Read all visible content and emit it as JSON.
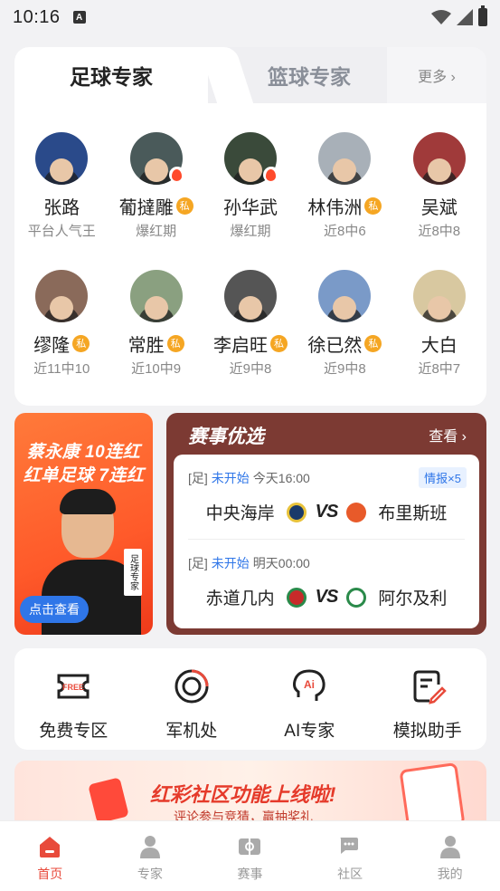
{
  "status_bar": {
    "time": "10:16",
    "a_label": "A"
  },
  "tabs": {
    "active": "足球专家",
    "inactive": "篮球专家",
    "more": "更多 ›"
  },
  "experts": [
    {
      "name": "张路",
      "sub": "平台人气王",
      "private": false,
      "hot": false,
      "color": "#2a4a8a"
    },
    {
      "name": "葡撻雕",
      "sub": "爆红期",
      "private": true,
      "hot": true,
      "color": "#4a5a5a"
    },
    {
      "name": "孙华武",
      "sub": "爆红期",
      "private": false,
      "hot": true,
      "color": "#3a4a3a"
    },
    {
      "name": "林伟洲",
      "sub": "近8中6",
      "private": true,
      "hot": false,
      "color": "#a8b0b8"
    },
    {
      "name": "吴斌",
      "sub": "近8中8",
      "private": false,
      "hot": false,
      "color": "#a03a3a"
    },
    {
      "name": "缪隆",
      "sub": "近11中10",
      "private": true,
      "hot": false,
      "color": "#8a6a5a"
    },
    {
      "name": "常胜",
      "sub": "近10中9",
      "private": true,
      "hot": false,
      "color": "#8aa080"
    },
    {
      "name": "李启旺",
      "sub": "近9中8",
      "private": true,
      "hot": false,
      "color": "#555"
    },
    {
      "name": "徐已然",
      "sub": "近9中8",
      "private": true,
      "hot": false,
      "color": "#7a9ac8"
    },
    {
      "name": "大白",
      "sub": "近8中7",
      "private": false,
      "hot": false,
      "color": "#d8c8a0"
    }
  ],
  "private_label": "私",
  "promo": {
    "line1": "蔡永康 10连红",
    "line2": "红单足球 7连红",
    "button": "点击查看",
    "tag": "足球专家"
  },
  "match": {
    "title": "赛事优选",
    "view": "查看 ›",
    "vs": "VS",
    "rows": [
      {
        "league": "[足]",
        "status": "未开始",
        "time": "今天16:00",
        "badge": "情报×5",
        "home": "中央海岸",
        "away": "布里斯班",
        "home_color": "#1a3a6a",
        "away_color": "#e85a2a"
      },
      {
        "league": "[足]",
        "status": "未开始",
        "time": "明天00:00",
        "badge": "",
        "home": "赤道几内",
        "away": "阿尔及利",
        "home_color": "#c82a2a",
        "away_color": "#2a8a4a"
      }
    ]
  },
  "tools": [
    {
      "label": "免费专区",
      "icon": "free-ticket-icon"
    },
    {
      "label": "军机处",
      "icon": "radar-icon"
    },
    {
      "label": "AI专家",
      "icon": "ai-head-icon"
    },
    {
      "label": "模拟助手",
      "icon": "edit-doc-icon"
    }
  ],
  "free_icon_text": "FREE",
  "ai_icon_text": "Ai",
  "ad": {
    "title": "红彩社区功能上线啦!",
    "sub": "评论参与竞猜，赢抽奖礼"
  },
  "nav": [
    {
      "label": "首页",
      "icon": "home-icon",
      "active": true
    },
    {
      "label": "专家",
      "icon": "person-icon",
      "active": false
    },
    {
      "label": "赛事",
      "icon": "field-icon",
      "active": false
    },
    {
      "label": "社区",
      "icon": "chat-icon",
      "active": false
    },
    {
      "label": "我的",
      "icon": "profile-icon",
      "active": false
    }
  ],
  "colors": {
    "accent": "#e84a3b",
    "blue": "#2f76e8",
    "match_bg": "#7c3a33",
    "private": "#f5a623"
  }
}
